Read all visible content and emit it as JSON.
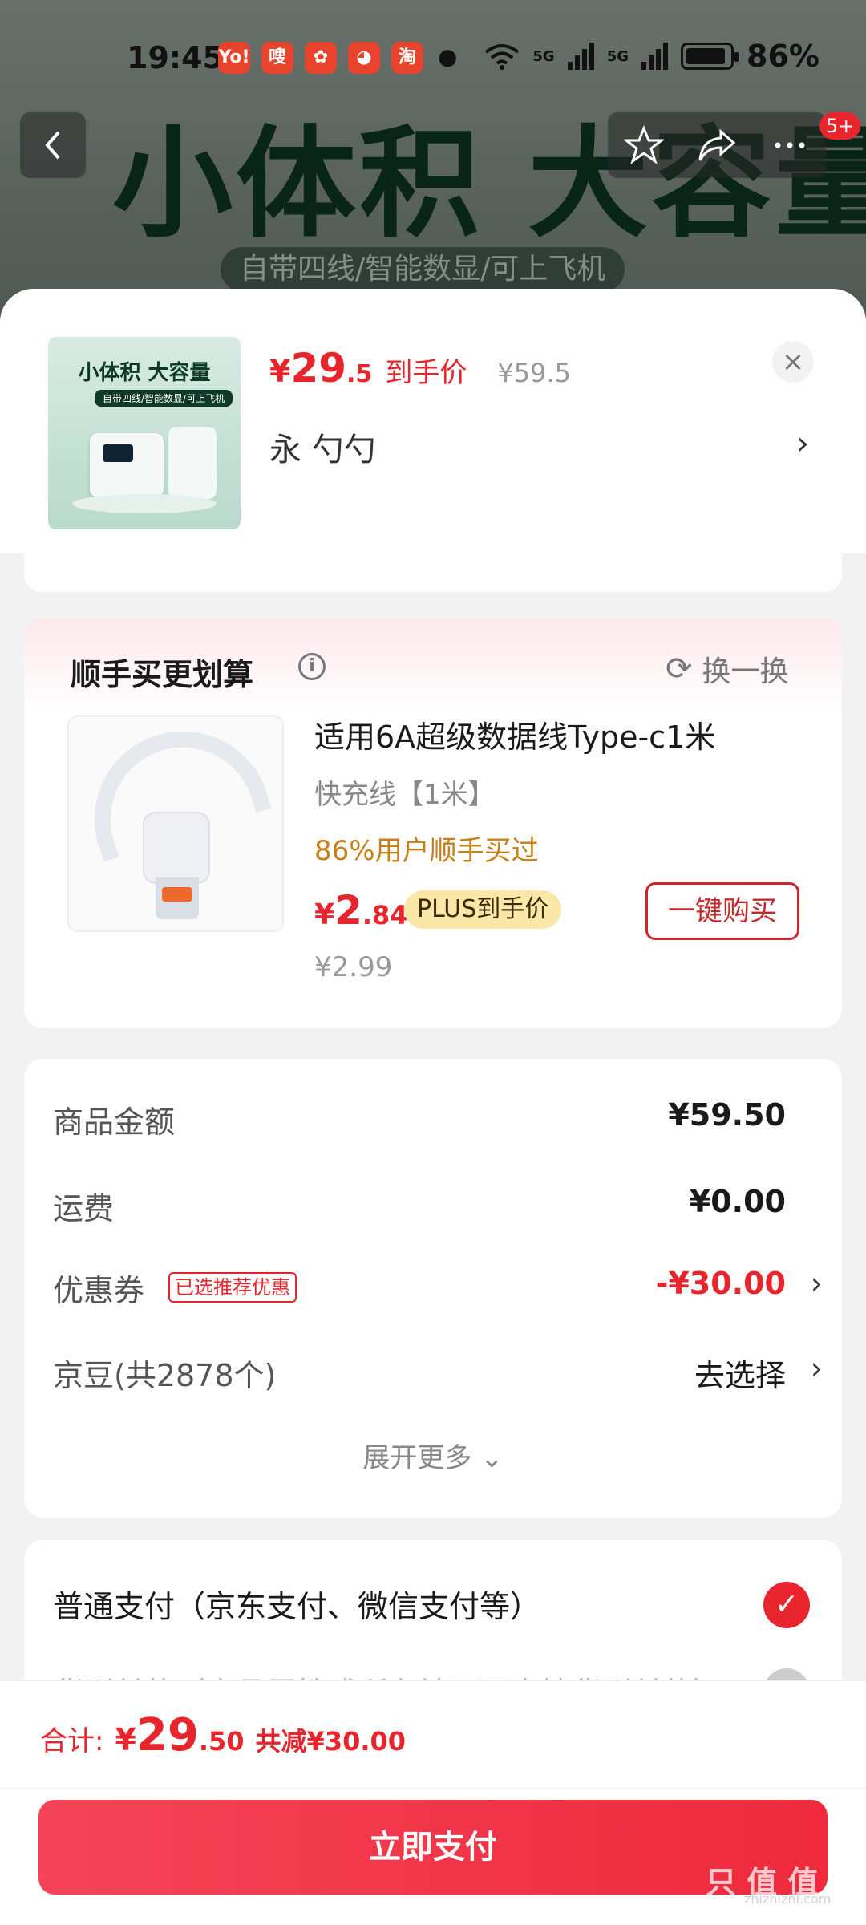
{
  "status": {
    "time": "19:45",
    "app_icons": [
      "Yo!",
      "嗖",
      "✿",
      "◕",
      "淘"
    ],
    "net1": "5G",
    "net2": "5G",
    "battery": "86%"
  },
  "background": {
    "banner": "小体积 大容量",
    "subtitle": "自带四线/智能数显/可上飞机",
    "badge": "5+"
  },
  "product": {
    "image_title": "小体积 大容量",
    "image_subtitle": "自带四线/智能数显/可上飞机",
    "price_currency": "¥",
    "price_int": "29",
    "price_dec": ".5",
    "price_label": "到手价",
    "original_price": "¥59.5",
    "spec": "永 勺勺",
    "close": "×",
    "chevron": "›"
  },
  "addon": {
    "title": "顺手买更划算",
    "info": "i",
    "refresh_icon": "⟳",
    "refresh_label": "换一换",
    "name": "适用6A超级数据线Type-c1米",
    "spec": "快充线【1米】",
    "stat": "86%用户顺手买过",
    "price_currency": "¥",
    "price_int": "2",
    "price_dec": ".84",
    "plus_tag": "PLUS到手价",
    "original_price": "¥2.99",
    "buy_button": "一键购买"
  },
  "fees": {
    "goods_label": "商品金额",
    "goods_value": "¥59.50",
    "shipping_label": "运费",
    "shipping_value": "¥0.00",
    "coupon_label": "优惠券",
    "coupon_tag": "已选推荐优惠",
    "coupon_value": "-¥30.00",
    "beans_label": "京豆(共2878个)",
    "beans_value": "去选择",
    "chevron": "›",
    "expand": "展开更多 ⌄"
  },
  "payment": {
    "option1": "普通支付（京东支付、微信支付等）",
    "check": "✓",
    "option2": "货到付款（商品属性或所在地区不支持货到付款）"
  },
  "bottom": {
    "total_label": "合计:",
    "total_currency": "¥",
    "total_int": "29",
    "total_dec": ".50",
    "saved": "共减¥30.00",
    "pay_button": "立即支付",
    "watermark": "只 值 值",
    "watermark_url": "zhizhizhi.com"
  },
  "colors": {
    "accent": "#e8242d",
    "stat_orange": "#c77f18",
    "plus_tag_bg": "#fbe7a8"
  }
}
